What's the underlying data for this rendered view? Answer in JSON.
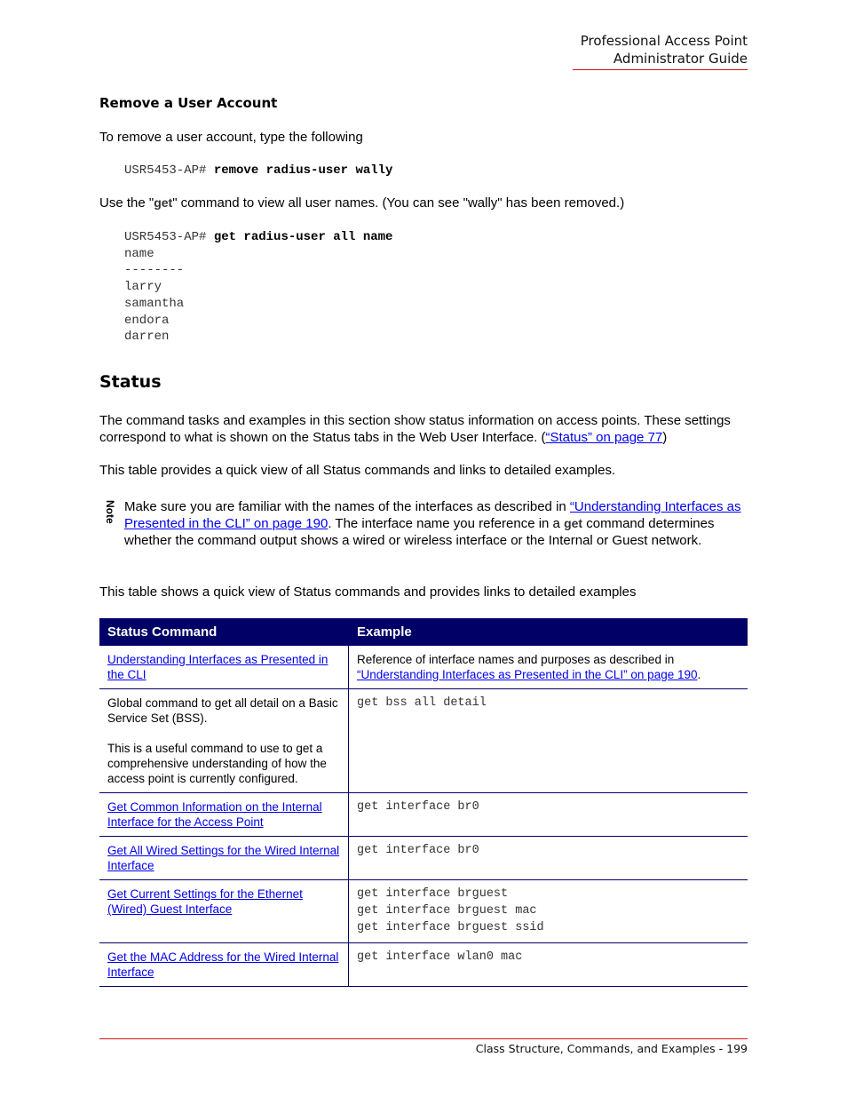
{
  "header": {
    "line1": "Professional Access Point",
    "line2": "Administrator Guide"
  },
  "remove_section": {
    "title": "Remove a User Account",
    "intro": "To remove a user account, type the following",
    "cmd_prompt": "USR5453-AP# ",
    "cmd_text": "remove radius-user wally",
    "get_pre": "Use the \"",
    "get_word": "get",
    "get_post": "\" command to view all user names. (You can see \"wally\" has been removed.)",
    "cmd2_prompt": "USR5453-AP# ",
    "cmd2_text": "get radius-user all name",
    "output_lines": [
      "name",
      "--------",
      "larry",
      "samantha",
      "endora",
      "darren"
    ]
  },
  "status_section": {
    "title": "Status",
    "para1_text": "The command tasks and examples in this section show status information on access points. These settings correspond to what is shown on the Status tabs in the Web User Interface. (",
    "para1_link": "“Status” on page 77",
    "para1_end": ")",
    "para2": "This table provides a quick view of all Status commands and links to detailed examples.",
    "note": {
      "label": "Note",
      "text_pre": "Make sure you are familiar with the names of the interfaces as described in ",
      "link": "“Understanding Interfaces as Presented in the CLI” on page 190",
      "text_mid": ". The interface name you reference in a ",
      "get_word": "get",
      "text_post": " command determines whether the command output shows a wired or wireless interface or the Internal or Guest network."
    },
    "para3": "This table shows a quick view of Status commands and provides links to detailed examples"
  },
  "table": {
    "headers": [
      "Status Command",
      "Example"
    ],
    "rows": [
      {
        "command_link": "Understanding Interfaces as Presented in the CLI",
        "example_pre": "Reference of interface names and purposes as described in ",
        "example_link": "“Understanding Interfaces as Presented in the CLI” on page 190",
        "example_post": "."
      },
      {
        "command_text1": "Global command to get all detail on a Basic Service Set (BSS).",
        "command_text2": "This is a useful command to use to get a comprehensive understanding of how the access point is currently configured.",
        "example_code": [
          "get bss all detail"
        ]
      },
      {
        "command_link": "Get Common Information on the Internal Interface for the Access Point",
        "example_code": [
          "get interface br0"
        ]
      },
      {
        "command_link": "Get All Wired Settings for the Wired Internal Interface",
        "example_code": [
          "get interface br0"
        ]
      },
      {
        "command_link": "Get Current Settings for the Ethernet (Wired) Guest Interface",
        "example_code": [
          "get interface brguest",
          "get interface brguest mac",
          "get interface brguest ssid"
        ]
      },
      {
        "command_link": "Get the MAC Address for the Wired Internal Interface",
        "example_code": [
          "get interface wlan0 mac"
        ]
      }
    ]
  },
  "footer": {
    "text": "Class Structure, Commands, and Examples - 199"
  }
}
